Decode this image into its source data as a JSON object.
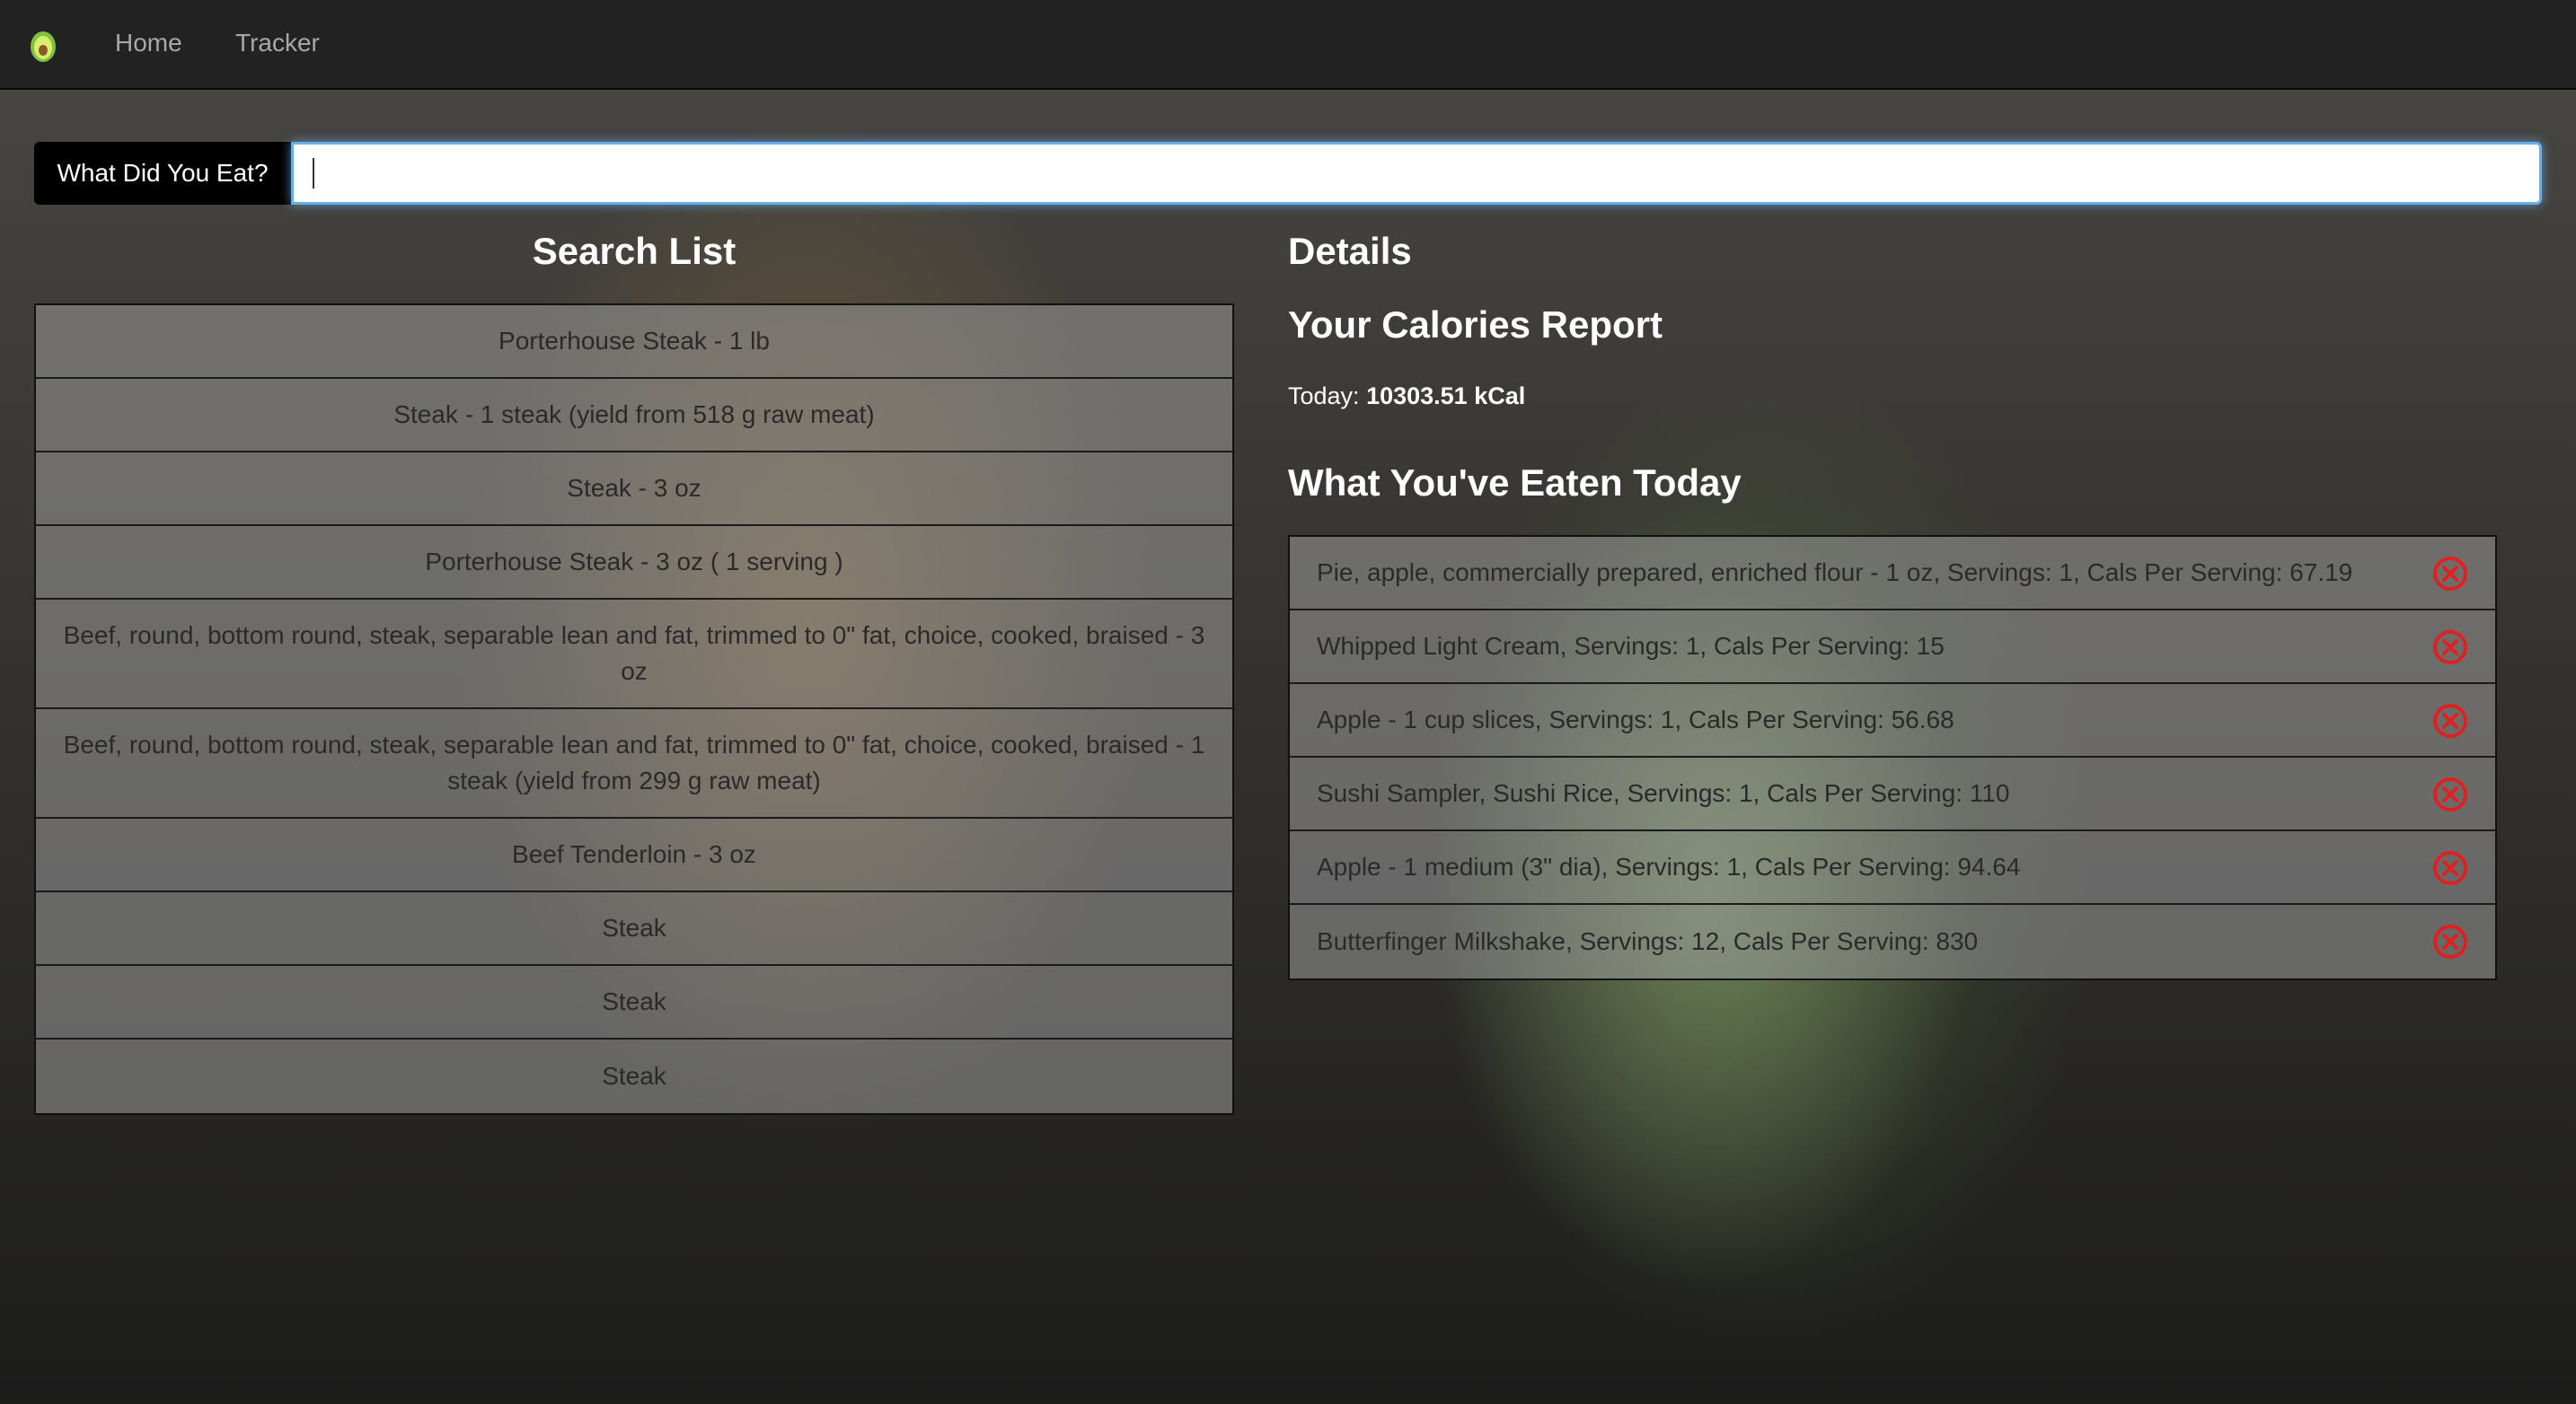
{
  "nav": {
    "logo_icon": "avocado-icon",
    "home_label": "Home",
    "tracker_label": "Tracker"
  },
  "search": {
    "label": "What Did You Eat?",
    "value": "",
    "placeholder": ""
  },
  "search_list": {
    "heading": "Search List",
    "items": [
      "Porterhouse Steak - 1 lb",
      "Steak - 1 steak (yield from 518 g raw meat)",
      "Steak - 3 oz",
      "Porterhouse Steak - 3 oz ( 1 serving )",
      "Beef, round, bottom round, steak, separable lean and fat, trimmed to 0\" fat, choice, cooked, braised - 3 oz",
      "Beef, round, bottom round, steak, separable lean and fat, trimmed to 0\" fat, choice, cooked, braised - 1 steak (yield from 299 g raw meat)",
      "Beef Tenderloin - 3 oz",
      "Steak",
      "Steak",
      "Steak"
    ]
  },
  "details": {
    "heading": "Details",
    "report_heading": "Your Calories Report",
    "today_label": "Today:",
    "today_value": "10303.51 kCal",
    "eaten_heading": "What You've Eaten Today",
    "remove_icon": "close-circle-icon",
    "remove_color": "#e02020",
    "eaten_items": [
      "Pie, apple, commercially prepared, enriched flour - 1 oz, Servings: 1, Cals Per Serving: 67.19",
      "Whipped Light Cream, Servings: 1, Cals Per Serving: 15",
      "Apple - 1 cup slices, Servings: 1, Cals Per Serving: 56.68",
      "Sushi Sampler, Sushi Rice, Servings: 1, Cals Per Serving: 110",
      "Apple - 1 medium (3\" dia), Servings: 1, Cals Per Serving: 94.64",
      "Butterfinger Milkshake, Servings: 12, Cals Per Serving: 830"
    ]
  }
}
